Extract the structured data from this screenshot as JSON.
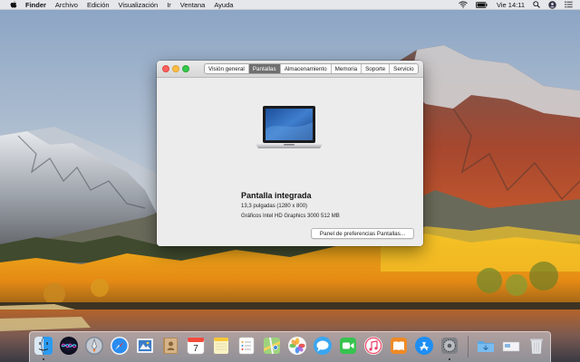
{
  "menubar": {
    "apple_icon": "apple-logo-icon",
    "items": [
      "Finder",
      "Archivo",
      "Edición",
      "Visualización",
      "Ir",
      "Ventana",
      "Ayuda"
    ],
    "status_icons": [
      "wifi-icon",
      "battery-icon",
      "search-icon",
      "user-icon",
      "list-icon"
    ],
    "clock": "Vie 14:11"
  },
  "window": {
    "tabs": [
      {
        "label": "Visión general",
        "active": false
      },
      {
        "label": "Pantallas",
        "active": true
      },
      {
        "label": "Almacenamiento",
        "active": false
      },
      {
        "label": "Memoria",
        "active": false
      },
      {
        "label": "Soporte",
        "active": false
      },
      {
        "label": "Servicio",
        "active": false
      }
    ],
    "display_name": "Pantalla integrada",
    "display_size": "13,3 pulgadas (1280 x 800)",
    "display_gpu": "Gráficos Intel HD Graphics 3000 512 MB",
    "prefs_button": "Panel de preferencias Pantallas..."
  },
  "dock": {
    "calendar_day": "7",
    "apps": [
      "finder-icon",
      "siri-icon",
      "launchpad-icon",
      "safari-icon",
      "mail-icon",
      "contacts-icon",
      "calendar-icon",
      "notes-icon",
      "reminders-icon",
      "maps-icon",
      "photos-icon",
      "messages-icon",
      "facetime-icon",
      "itunes-icon",
      "ibooks-icon",
      "app-store-icon",
      "system-preferences-icon",
      "downloads-folder-icon",
      "document-stack-icon",
      "trash-icon"
    ]
  },
  "colors": {
    "accent_tab": "#6f6f6f",
    "close": "#fc605c",
    "minimize": "#fdbc40",
    "zoom": "#34c84a"
  }
}
